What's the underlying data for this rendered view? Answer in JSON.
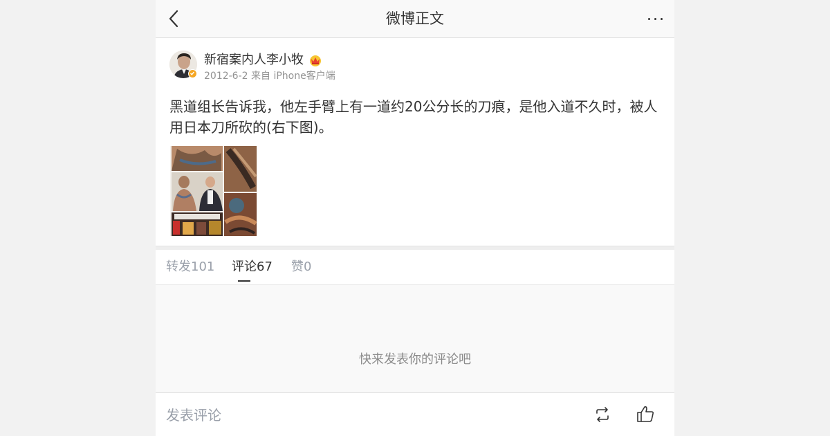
{
  "header": {
    "title": "微博正文"
  },
  "post": {
    "user_name": "新宿案内人李小牧",
    "meta": "2012-6-2 来自 iPhone客户端",
    "text": "黑道组长告诉我，他左手臂上有一道约20公分长的刀痕，是他入道不久时，被人用日本刀所砍的(右下图)。",
    "verified_color": "#f5a623"
  },
  "tabs": [
    {
      "label": "转发101"
    },
    {
      "label": "评论67",
      "active": true
    },
    {
      "label": "赞0"
    }
  ],
  "comments": {
    "empty_hint": "快来发表你的评论吧"
  },
  "bottom_bar": {
    "input_placeholder": "发表评论"
  },
  "icons": {
    "back": "chevron-left-icon",
    "more": "more-dots-icon",
    "repost": "repost-icon",
    "like": "thumbs-up-icon"
  }
}
